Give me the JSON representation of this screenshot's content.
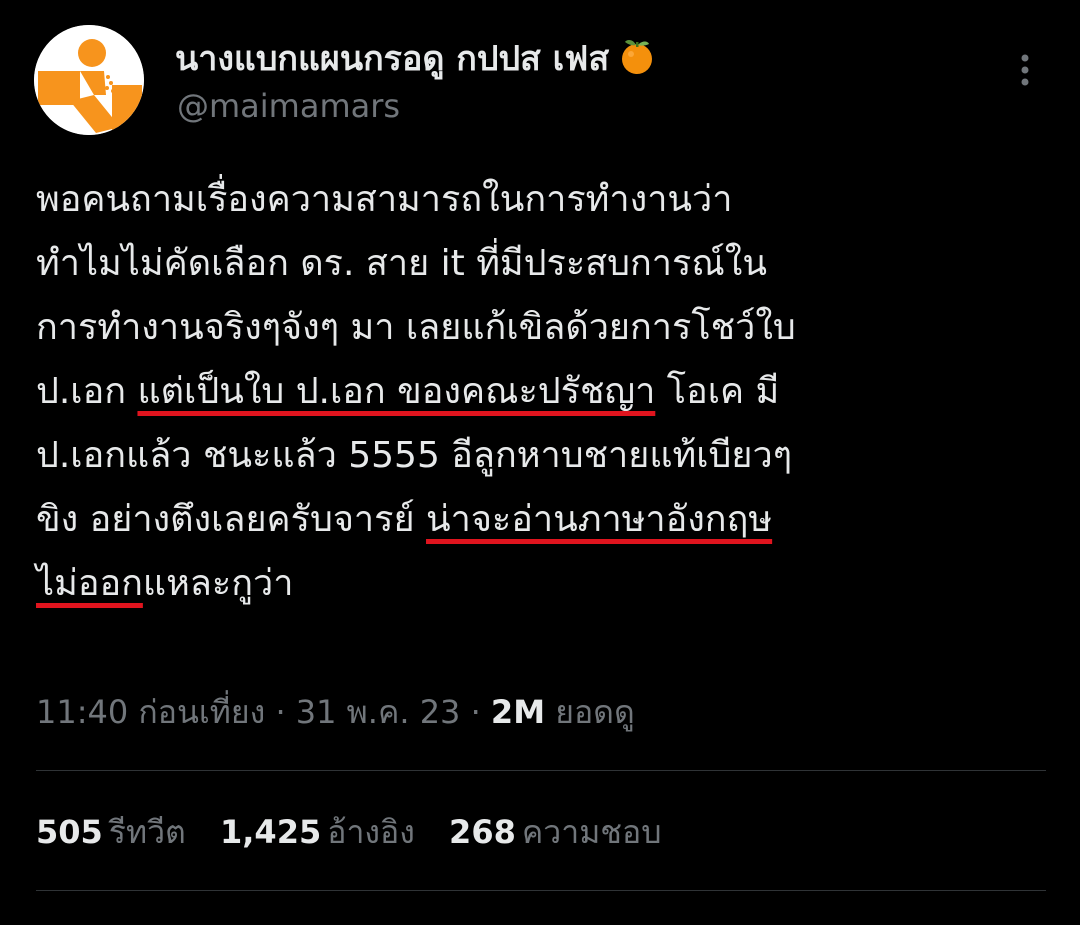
{
  "header": {
    "display_name": "นางแบกแผนกรอดู กปปส เฟส",
    "name_emoji": "tangerine-icon",
    "handle": "@maimamars",
    "avatar": "avatar-person-icon",
    "more_icon": "more-vertical-icon"
  },
  "tweet": {
    "lines": [
      [
        {
          "text": "พอคนถามเรื่องความสามารถในการทำงานว่า"
        }
      ],
      [
        {
          "text": "ทำไมไม่คัดเลือก ดร. สาย it ที่มีประสบการณ์ใน"
        }
      ],
      [
        {
          "text": "การทำงานจริงๆจังๆ มา เลยแก้เขิลด้วยการโชว์ใบ"
        }
      ],
      [
        {
          "text": "ป.เอก "
        },
        {
          "text": "แต่เป็นใบ ป.เอก ของคณะปรัชญา",
          "underline": true
        },
        {
          "text": " โอเค มี"
        }
      ],
      [
        {
          "text": "ป.เอกแล้ว ชนะแล้ว 5555  อีลูกหาบชายแท้เบียวๆ"
        }
      ],
      [
        {
          "text": "ขิง อย่างตึงเลยครับจารย์ "
        },
        {
          "text": "น่าจะอ่านภาษาอังกฤษ",
          "underline": true
        }
      ],
      [
        {
          "text": "ไม่ออก",
          "underline": true
        },
        {
          "text": "แหละกูว่า"
        }
      ]
    ]
  },
  "meta": {
    "time": "11:40 ก่อนเที่ยง",
    "separator": "·",
    "date": "31 พ.ค. 23",
    "views_count": "2M",
    "views_label": "ยอดดู"
  },
  "stats": {
    "retweets_count": "505",
    "retweets_label": "รีทวีต",
    "quotes_count": "1,425",
    "quotes_label": "อ้างอิง",
    "likes_count": "268",
    "likes_label": "ความชอบ"
  },
  "colors": {
    "background": "#000000",
    "text": "#e7e9ea",
    "secondary": "#71767b",
    "underline": "#e0141e",
    "avatar_orange": "#f7941d"
  }
}
